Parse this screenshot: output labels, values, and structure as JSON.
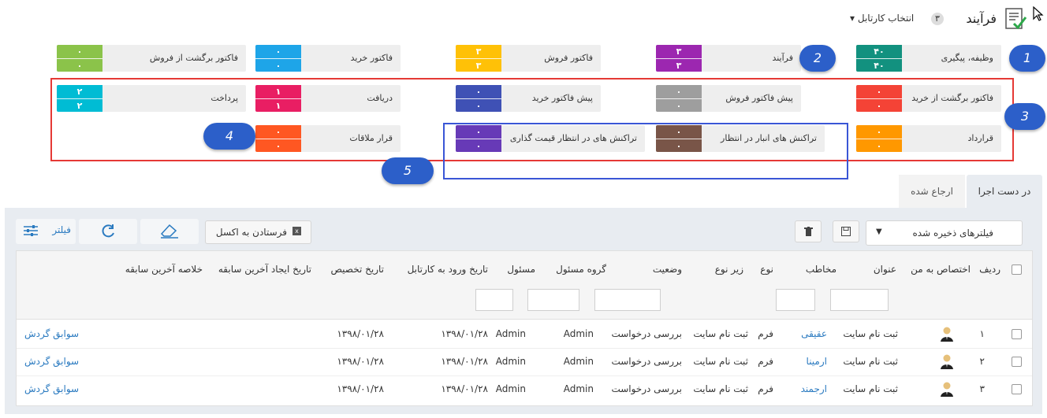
{
  "header": {
    "title": "فرآیند",
    "count": "۳",
    "select_label": "انتخاب کارتابل"
  },
  "tiles": [
    {
      "label": "وظیفه، پیگیری",
      "top": "۴۰",
      "bottom": "۴۰",
      "color": "#12917f"
    },
    {
      "label": "فرآیند",
      "top": "۳",
      "bottom": "۳",
      "color": "#9c27b0"
    },
    {
      "label": "فاکتور فروش",
      "top": "۳",
      "bottom": "۳",
      "color": "#ffc107"
    },
    {
      "label": "فاکتور خرید",
      "top": "۰",
      "bottom": "۰",
      "color": "#1ea5e8"
    },
    {
      "label": "فاکتور برگشت از فروش",
      "top": "۰",
      "bottom": "۰",
      "color": "#8bc34a"
    },
    {
      "label": "فاکتور برگشت از خرید",
      "top": "۰",
      "bottom": "۰",
      "color": "#f44336"
    },
    {
      "label": "پیش فاکتور فروش",
      "top": "۰",
      "bottom": "۰",
      "color": "#9e9e9e"
    },
    {
      "label": "پیش فاکتور خرید",
      "top": "۰",
      "bottom": "۰",
      "color": "#3f51b5"
    },
    {
      "label": "دریافت",
      "top": "۱",
      "bottom": "۱",
      "color": "#e91e63"
    },
    {
      "label": "پرداخت",
      "top": "۲",
      "bottom": "۲",
      "color": "#00bcd4"
    },
    {
      "label": "قرارداد",
      "top": "۰",
      "bottom": "۰",
      "color": "#ff9800"
    },
    {
      "label": "تراکنش های انبار در انتظار",
      "top": "۰",
      "bottom": "۰",
      "color": "#795548"
    },
    {
      "label": "تراکنش های در انتظار قیمت گذاری",
      "top": "۰",
      "bottom": "۰",
      "color": "#673ab7"
    },
    {
      "label": "قرار ملاقات",
      "top": "۰",
      "bottom": "۰",
      "color": "#ff5722"
    }
  ],
  "callouts": [
    "1",
    "2",
    "3",
    "4",
    "5"
  ],
  "tabs": {
    "active": "در دست اجرا",
    "other": "ارجاع شده"
  },
  "toolbar": {
    "saved_filters": "فیلترهای ذخیره شده",
    "excel": "فرستادن به اکسل",
    "filter": "فیلتر"
  },
  "table": {
    "headers": {
      "row": "ردیف",
      "assigned": "اختصاص به من",
      "title": "عنوان",
      "contact": "مخاطب",
      "type": "نوع",
      "subtype": "زیر نوع",
      "status": "وضعیت",
      "group": "گروه مسئول",
      "owner": "مسئول",
      "entry_date": "تاریخ ورود به کارتابل",
      "assign_date": "تاریخ تخصیص",
      "last_date": "تاریخ ایجاد آخرین سابقه",
      "last_summary": "خلاصه آخرین سابقه"
    },
    "rows": [
      {
        "num": "۱",
        "title": "ثبت نام سایت",
        "contact": "عقیقی",
        "type": "فرم",
        "subtype": "ثبت نام سایت",
        "status": "بررسی درخواست",
        "group": "Admin",
        "owner": "Admin",
        "entry_date": "۱۳۹۸/۰۱/۲۸",
        "assign_date": "۱۳۹۸/۰۱/۲۸",
        "link": "سوابق گردش"
      },
      {
        "num": "۲",
        "title": "ثبت نام سایت",
        "contact": "ارمینا",
        "type": "فرم",
        "subtype": "ثبت نام سایت",
        "status": "بررسی درخواست",
        "group": "Admin",
        "owner": "Admin",
        "entry_date": "۱۳۹۸/۰۱/۲۸",
        "assign_date": "۱۳۹۸/۰۱/۲۸",
        "link": "سوابق گردش"
      },
      {
        "num": "۳",
        "title": "ثبت نام سایت",
        "contact": "ارجمند",
        "type": "فرم",
        "subtype": "ثبت نام سایت",
        "status": "بررسی درخواست",
        "group": "Admin",
        "owner": "Admin",
        "entry_date": "۱۳۹۸/۰۱/۲۸",
        "assign_date": "۱۳۹۸/۰۱/۲۸",
        "link": "سوابق گردش"
      }
    ]
  }
}
